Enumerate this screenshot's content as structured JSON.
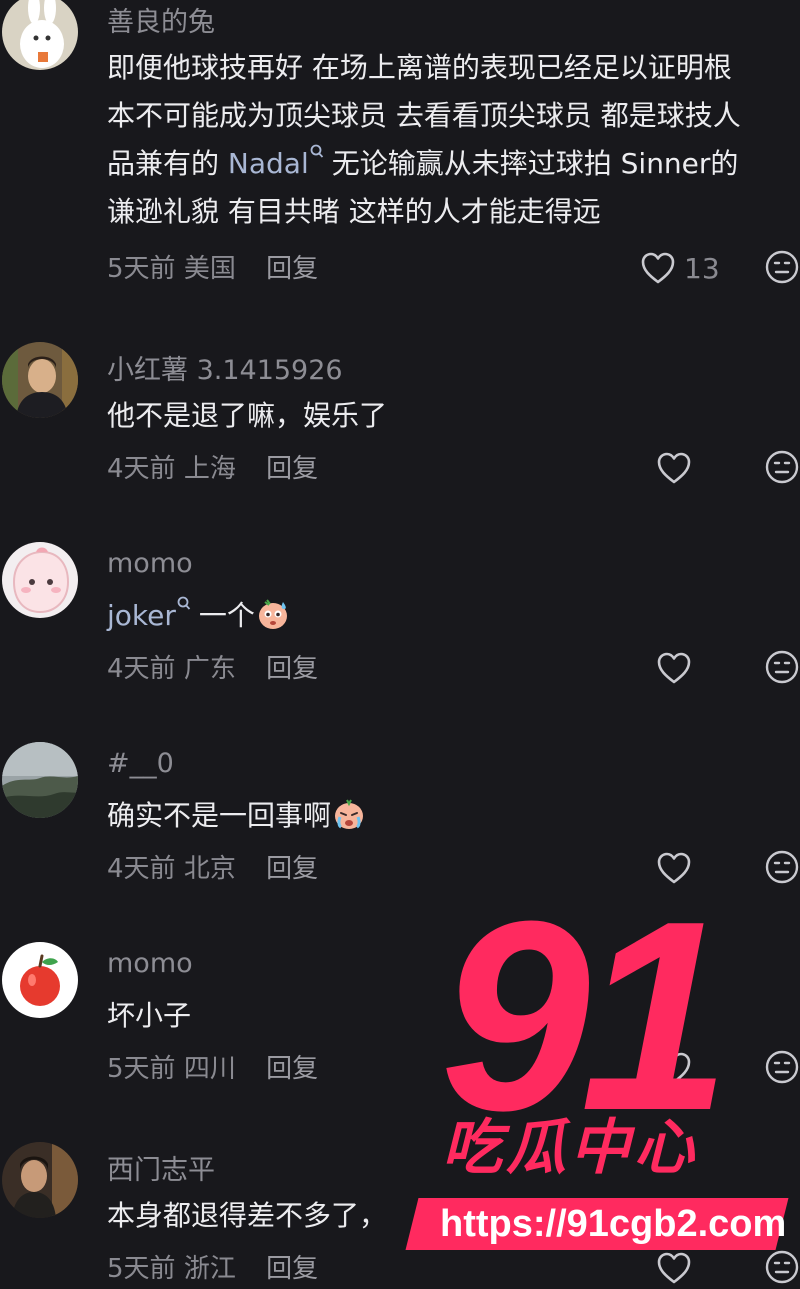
{
  "comments": [
    {
      "username": "善良的兔",
      "lines": [
        "即便他球技再好 在场上离谱的表现已经足以证明根",
        "本不可能成为顶尖球员 去看看顶尖球员 都是球技人"
      ],
      "line3_pre": "品兼有的 ",
      "mention1": "Nadal",
      "line3_post": "无论输赢从未摔过球拍 Sinner的",
      "line4": "谦逊礼貌 有目共睹 这样的人才能走得远",
      "time": "5天前",
      "location": "美国",
      "reply": "回复",
      "likes": "13"
    },
    {
      "username": "小红薯 3.1415926",
      "text": "他不是退了嘛，娱乐了",
      "time": "4天前",
      "location": "上海",
      "reply": "回复"
    },
    {
      "username": "momo",
      "mention": "joker",
      "text": "一个",
      "time": "4天前",
      "location": "广东",
      "reply": "回复"
    },
    {
      "username": "#__0",
      "text": "确实不是一回事啊",
      "time": "4天前",
      "location": "北京",
      "reply": "回复"
    },
    {
      "username": "momo",
      "text": "坏小子",
      "time": "5天前",
      "location": "四川",
      "reply": "回复"
    },
    {
      "username": "西门志平",
      "text": "本身都退得差不多了，",
      "time": "5天前",
      "location": "浙江",
      "reply": "回复"
    }
  ],
  "icons": {
    "like": "heart-outline-icon",
    "dislike": "neutral-face-icon",
    "mention": "search-icon"
  },
  "watermark": {
    "number": "91",
    "subtitle": "吃瓜中心",
    "url": "https://91cgb2.com",
    "color": "#ff2a5f"
  }
}
